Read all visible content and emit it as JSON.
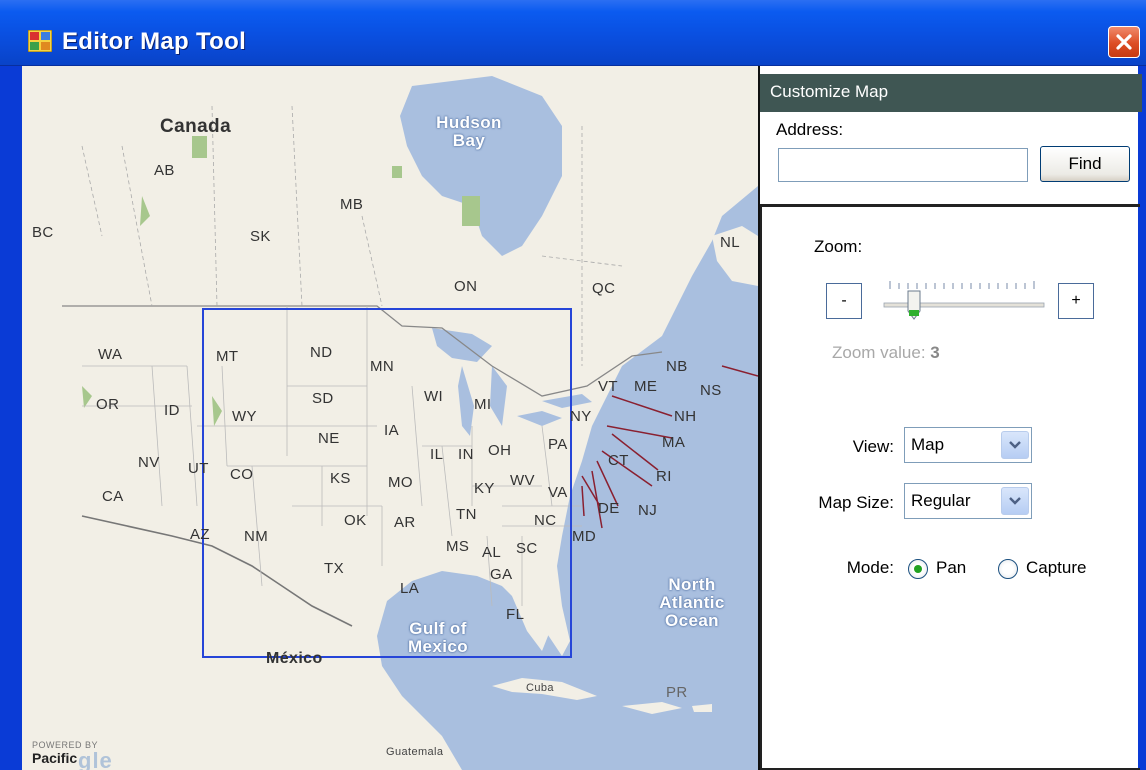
{
  "window": {
    "title": "Editor Map Tool",
    "close_glyph": "✕"
  },
  "map": {
    "countries": {
      "canada": "Canada",
      "mexico": "México"
    },
    "water": {
      "hudson_bay": "Hudson Bay",
      "gulf": "Gulf of Mexico",
      "atlantic": "North Atlantic Ocean"
    },
    "places": {
      "cuba": "Cuba",
      "pr": "PR",
      "guatemala": "Guatemala"
    },
    "provinces": [
      "BC",
      "AB",
      "SK",
      "MB",
      "ON",
      "QC",
      "NL",
      "NB",
      "NS"
    ],
    "states": [
      "WA",
      "OR",
      "CA",
      "ID",
      "NV",
      "MT",
      "WY",
      "UT",
      "AZ",
      "CO",
      "NM",
      "ND",
      "SD",
      "NE",
      "KS",
      "OK",
      "TX",
      "MN",
      "IA",
      "MO",
      "AR",
      "LA",
      "WI",
      "IL",
      "MI",
      "IN",
      "OH",
      "KY",
      "TN",
      "MS",
      "AL",
      "GA",
      "FL",
      "SC",
      "NC",
      "VA",
      "WV",
      "PA",
      "NY",
      "VT",
      "ME",
      "NH",
      "MA",
      "CT",
      "RI",
      "NJ",
      "DE",
      "MD"
    ],
    "powered_by": "POWERED BY",
    "region": "Pacific",
    "logo_fragment": "gle"
  },
  "panel": {
    "header": "Customize Map",
    "address_label": "Address:",
    "address_value": "",
    "find_label": "Find",
    "zoom_label": "Zoom:",
    "zoom_minus": "-",
    "zoom_plus": "+",
    "zoom_value_label": "Zoom value:",
    "zoom_value": "3",
    "view_label": "View:",
    "view_value": "Map",
    "map_size_label": "Map Size:",
    "map_size_value": "Regular",
    "mode_label": "Mode:",
    "mode_options": [
      "Pan",
      "Capture"
    ],
    "mode_selected": "Pan"
  },
  "colors": {
    "titlebar": "#0a4fe0",
    "panel_header": "#3f5653",
    "water": "#a9bfdf",
    "land": "#f2efe6",
    "capture_rect": "#2645d8"
  }
}
